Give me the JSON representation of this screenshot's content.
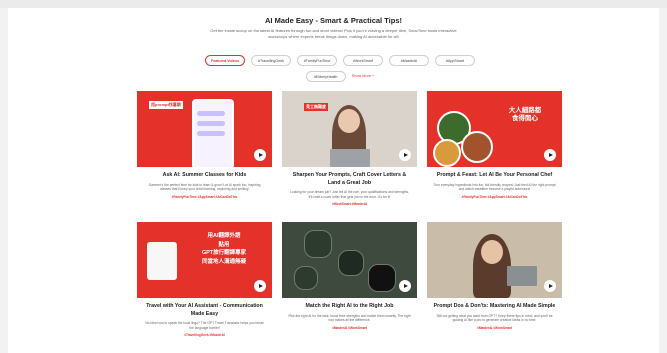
{
  "header": {
    "title": "AI Made Easy - Smart & Practical Tips!",
    "subtitle": "Get the inside scoop on the latest AI features through fun and short videos! Plus if you're craving a deeper dive, SmarTone hosts interactive workshops where experts break things down, making AI accessible for all!"
  },
  "tabs": [
    {
      "label": "Featured Videos",
      "active": true
    },
    {
      "label": "#TravellingGeek",
      "active": false
    },
    {
      "label": "#FamilyFunTime",
      "active": false
    },
    {
      "label": "#WorkSmart",
      "active": false
    },
    {
      "label": "#MasterAI",
      "active": false
    },
    {
      "label": "#AppSmart",
      "active": false
    },
    {
      "label": "#ElderlyHealth",
      "active": false
    }
  ],
  "show_more": "Show More +",
  "cards": [
    {
      "title": "Ask AI: Summer Classes for Kids",
      "desc": "Summer's the perfect time for kids to learn & grow! Let AI spark fun, inspiring classes that'll keep your child learning, exploring and smiling!",
      "tags": "#FamilyFunTime   #AppSmart   #AiCanDoThis",
      "thumb_text": "用prompt找暑期"
    },
    {
      "title": "Sharpen Your Prompts, Craft Cover Letters & Land a Great Job",
      "desc": "Looking for your dream job? Just tell AI the role, your qualifications and strengths, it'll craft a cover letter that gets you in the door. Go for it!",
      "tags": "#WorkSmart   #MasterAI",
      "thumb_text": "見工無難度"
    },
    {
      "title": "Prompt & Feast: Let AI Be Your Personal Chef",
      "desc": "Turn everyday ingredients into fun, kid-friendly recipes! Just feed AI the right prompt and watch mealtime become a playful adventure!",
      "tags": "#FamilyFunTime   #AppSmart   #AiCanDoThis",
      "thumb_text": "大人細路都\n食得開心"
    },
    {
      "title": "Travel with Your AI Assistant - Communication Made Easy",
      "desc": "No idea how to speak the local lingo? The GPT Travel Translator helps you break the language barrier!",
      "tags": "#TravellingGeek   #MasterAI",
      "thumb_text": "用AI翻譯外語\n點用\nGPT旅行翻譯專家\n同當地人溝通無礙"
    },
    {
      "title": "Match the Right AI to the Right Job",
      "desc": "Pick the right AI for the task: know their strengths and match them smartly. The right tool makes all the difference.",
      "tags": "#MasterAI   #WorkSmart",
      "thumb_text": ""
    },
    {
      "title": "Prompt Dos & Don'ts: Mastering AI Made Simple",
      "desc": "Still not getting what you want from GPT? Keep these tips in mind, and you'll be guiding AI like a pro to generate creative ideas in no time.",
      "tags": "#MasterAI   #WorkSmart",
      "thumb_text": ""
    }
  ],
  "colors": {
    "accent": "#e4322b",
    "bg": "#f2f2f2"
  }
}
